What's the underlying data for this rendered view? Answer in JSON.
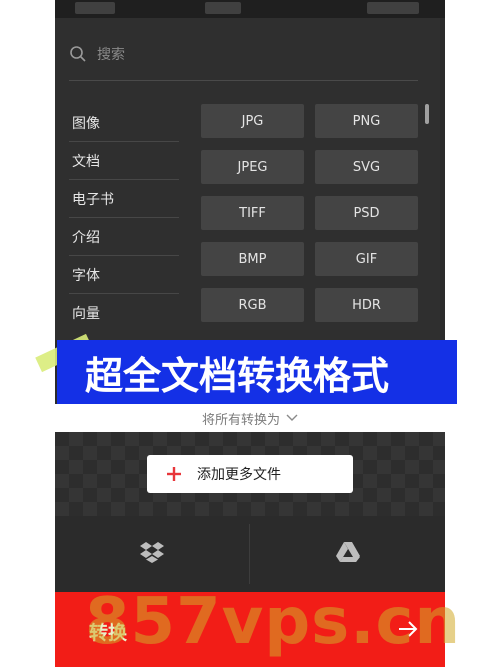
{
  "search": {
    "placeholder": "搜索"
  },
  "categories": [
    "图像",
    "文档",
    "电子书",
    "介绍",
    "字体",
    "向量"
  ],
  "formats": [
    "JPG",
    "PNG",
    "JPEG",
    "SVG",
    "TIFF",
    "PSD",
    "BMP",
    "GIF",
    "RGB",
    "HDR"
  ],
  "banner": {
    "text": "超全文档转换格式"
  },
  "convert_all": {
    "label": "将所有转换为"
  },
  "add_files": {
    "label": "添加更多文件"
  },
  "convert": {
    "label": "转换"
  },
  "watermark": {
    "text": "857vps.cn"
  },
  "colors": {
    "accent_red": "#f21d17",
    "banner_blue": "#1430e6",
    "plus_red": "#e8363a"
  }
}
